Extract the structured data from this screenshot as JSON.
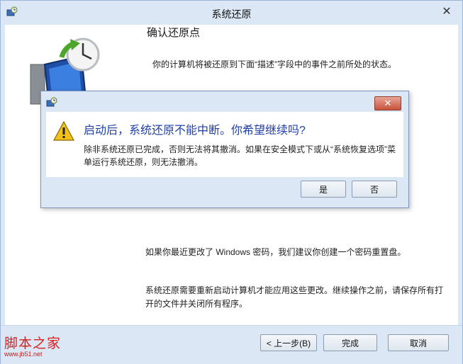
{
  "window": {
    "title": "系统还原",
    "close_glyph": "✕",
    "title_icon": "system-restore-icon"
  },
  "main": {
    "heading": "确认还原点",
    "description": "你的计算机将被还原到下面“描述”字段中的事件之前所处的状态。",
    "password_note": "如果你最近更改了 Windows 密码，我们建议你创建一个密码重置盘。",
    "restart_note": "系统还原需要重新启动计算机才能应用这些更改。继续操作之前，请保存所有打开的文件并关闭所有程序。",
    "illustration_icon": "restore-clock-monitor-icon"
  },
  "footer": {
    "back_label": "< 上一步(B)",
    "finish_label": "完成",
    "cancel_label": "取消"
  },
  "watermark": {
    "main": "脚本之家",
    "sub": "www.jb51.net"
  },
  "dialog": {
    "title_icon": "system-restore-icon",
    "close_glyph": "✕",
    "warning_icon": "warning-icon",
    "question": "启动后，系统还原不能中断。你希望继续吗?",
    "message": "除非系统还原已完成，否则无法将其撤消。如果在安全模式下或从“系统恢复选项”菜单运行系统还原，则无法撤消。",
    "yes_label": "是",
    "no_label": "否"
  }
}
